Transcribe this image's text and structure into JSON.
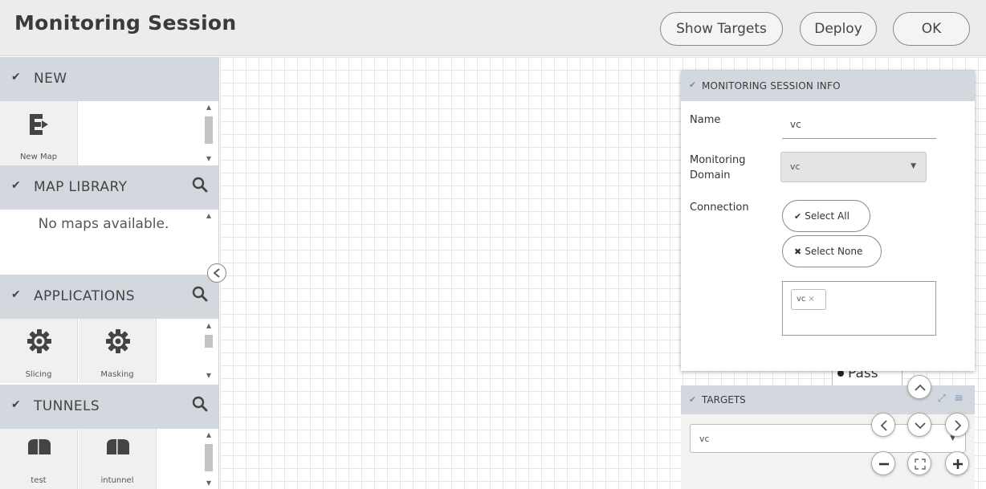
{
  "header": {
    "title": "Monitoring Session",
    "buttons": {
      "show_targets": "Show Targets",
      "deploy": "Deploy",
      "ok": "OK"
    }
  },
  "sidebar": {
    "new": {
      "title": "NEW",
      "tiles": [
        {
          "label": "New Map",
          "icon": "new-map-icon"
        }
      ]
    },
    "map_library": {
      "title": "MAP LIBRARY",
      "empty": "No maps available."
    },
    "applications": {
      "title": "APPLICATIONS",
      "tiles": [
        {
          "label": "Slicing",
          "icon": "gear-icon"
        },
        {
          "label": "Masking",
          "icon": "gear-icon"
        }
      ]
    },
    "tunnels": {
      "title": "TUNNELS",
      "tiles": [
        {
          "label": "test",
          "icon": "tunnel-icon"
        },
        {
          "label": "intunnel",
          "icon": "tunnel-icon"
        }
      ]
    }
  },
  "info_panel": {
    "title": "MONITORING SESSION INFO",
    "name_label": "Name",
    "name_value": "vc",
    "domain_label": "Monitoring Domain",
    "domain_value": "vc",
    "connection_label": "Connection",
    "select_all": "Select All",
    "select_none": "Select None",
    "tag": "vc",
    "tag_remove": "×"
  },
  "canvas": {
    "node_label": "Pass"
  },
  "targets_panel": {
    "title": "TARGETS",
    "value": "vc"
  },
  "colors": {
    "header_bg": "#ececec",
    "section_bg": "#d3d8de",
    "grid_line": "#e6e6e6",
    "accent": "#7a9cc7"
  }
}
